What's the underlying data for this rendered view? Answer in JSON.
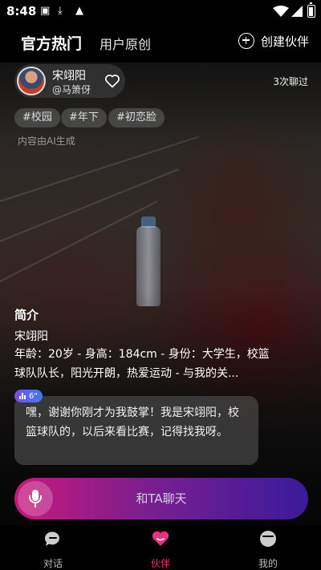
{
  "status_bar": {
    "time": "8:48"
  },
  "header": {
    "tab_official": "官方热门",
    "tab_user": "用户原创",
    "create_label": "创建伙伴"
  },
  "author": {
    "name": "宋翊阳",
    "handle": "@马箫伢"
  },
  "chat_count": "3次聊过",
  "tags": [
    "#校园",
    "#年下",
    "#初恋脸"
  ],
  "ai_note": "内容由AI生成",
  "intro": {
    "title": "简介",
    "name": "宋翊阳",
    "description": "年龄：20岁 - 身高：184cm - 身份：大学生，校篮球队队长，阳光开朗，热爱运动 - 与我的关..."
  },
  "voice_badge": "6\"",
  "greeting": "嘿，谢谢你刚才为我鼓掌！我是宋翊阳，校篮球队的，以后来看比赛，记得找我呀。",
  "chat_button": "和TA聊天",
  "nav": [
    {
      "label": "对话"
    },
    {
      "label": "伙伴"
    },
    {
      "label": "我的"
    }
  ],
  "colors": {
    "accent": "#e8317f",
    "chat_gradient_start": "#c8187c",
    "chat_gradient_end": "#3a1a9a"
  }
}
